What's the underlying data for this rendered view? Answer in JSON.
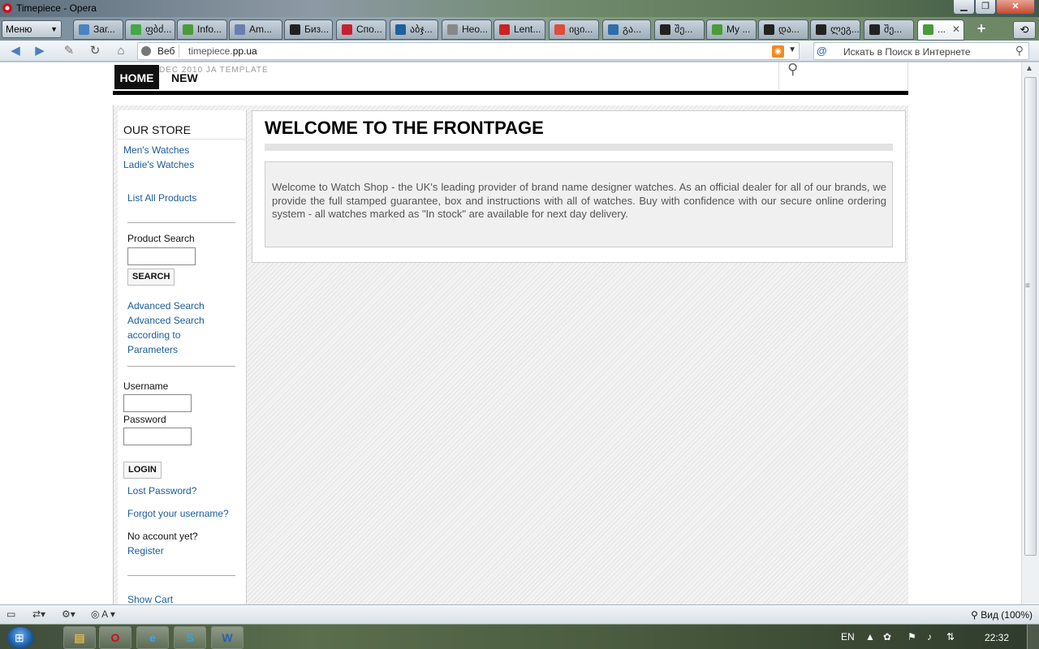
{
  "window": {
    "title": "Timepiece - Opera"
  },
  "browser": {
    "menu_label": "Меню",
    "tabs": [
      {
        "label": "Заг...",
        "icon": "download-icon"
      },
      {
        "label": "ფბძ...",
        "icon": "g-icon"
      },
      {
        "label": "Info...",
        "icon": "tree-icon"
      },
      {
        "label": "Am...",
        "icon": "site-icon"
      },
      {
        "label": "Биз...",
        "icon": "r-icon"
      },
      {
        "label": "Спо...",
        "icon": "news-icon"
      },
      {
        "label": "აბჯ...",
        "icon": "infobox-icon"
      },
      {
        "label": "Нео...",
        "icon": "blank-icon"
      },
      {
        "label": "Lent...",
        "icon": "lenta-icon"
      },
      {
        "label": "იცი...",
        "icon": "google-icon"
      },
      {
        "label": "გა...",
        "icon": "shield-icon"
      },
      {
        "label": "შე...",
        "icon": "wordpress-icon"
      },
      {
        "label": "My ...",
        "icon": "tree-icon"
      },
      {
        "label": "და...",
        "icon": "wordpress-icon"
      },
      {
        "label": "ლეგ...",
        "icon": "wordpress-icon"
      },
      {
        "label": "შე...",
        "icon": "wordpress-icon"
      },
      {
        "label": "...",
        "icon": "tree-icon"
      }
    ],
    "address": {
      "prefix": "Веб",
      "url_host": "timepiece.",
      "url_domain": "pp.ua"
    },
    "search": {
      "engine": "@",
      "placeholder": "Искать в Поиск в Интернете"
    },
    "status_zoom": "Вид (100%)"
  },
  "site": {
    "template_text": "DEC 2010 JA TEMPLATE",
    "nav": {
      "home": "HOME",
      "new": "NEW"
    },
    "sidebar": {
      "store_title": "OUR STORE",
      "links": [
        "Men's Watches",
        "Ladie's Watches"
      ],
      "list_all": "List All Products",
      "product_search_label": "Product Search",
      "search_button": "SEARCH",
      "advanced_search": "Advanced Search",
      "advanced_params": [
        "Advanced Search",
        "according to",
        "Parameters"
      ],
      "username_label": "Username",
      "password_label": "Password",
      "login_button": "LOGIN",
      "lost_password": "Lost Password?",
      "forgot_username": "Forgot your username?",
      "no_account": "No account yet?",
      "register": "Register",
      "show_cart": "Show Cart"
    },
    "main": {
      "heading": "WELCOME TO THE FRONTPAGE",
      "body": "Welcome to Watch Shop - the UK's leading provider of brand name designer watches. As an official dealer for all of our brands, we provide the full stamped guarantee, box and instructions with all of watches. Buy with confidence with our secure online ordering system - all watches marked as \"In stock\" are available for next day delivery."
    }
  },
  "taskbar": {
    "lang": "EN",
    "clock": "22:32"
  }
}
